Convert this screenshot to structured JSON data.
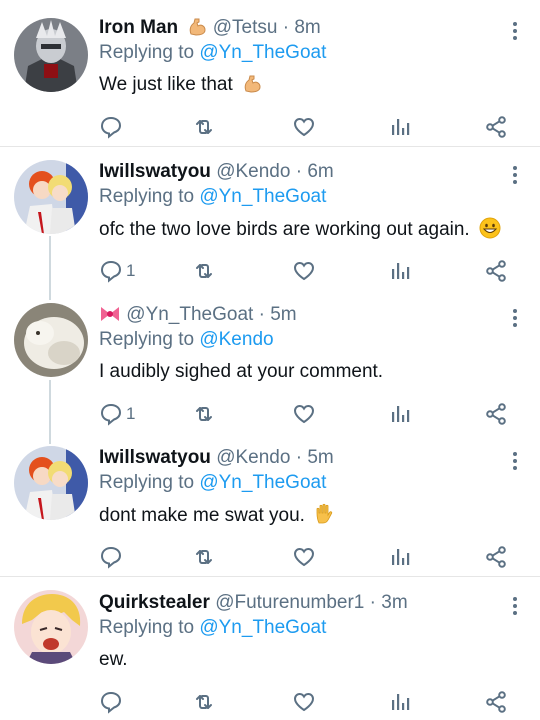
{
  "tweets": [
    {
      "name": "Iron Man",
      "name_emoji": "flexed-biceps",
      "handle": "@Tetsu",
      "separator": "·",
      "time": "8m",
      "replying_prefix": "Replying to ",
      "replying_to": "@Yn_TheGoat",
      "text": "We just like that",
      "text_emoji": "flexed-biceps",
      "reply_count": "",
      "avatar": "armored-figure-avatar"
    },
    {
      "name": "Iwillswatyou",
      "handle": "@Kendo",
      "separator": "·",
      "time": "6m",
      "replying_prefix": "Replying to ",
      "replying_to": "@Yn_TheGoat",
      "text": "ofc the two love birds are working out again.",
      "text_emoji": "grinning-face",
      "reply_count": "1",
      "avatar": "anime-pair-avatar"
    },
    {
      "name": "",
      "name_emoji": "ribbon",
      "handle": "@Yn_TheGoat",
      "separator": "·",
      "time": "5m",
      "replying_prefix": "Replying to ",
      "replying_to": "@Kendo",
      "text": "I audibly sighed at your comment.",
      "reply_count": "1",
      "avatar": "fluffy-white-animal-avatar"
    },
    {
      "name": "Iwillswatyou",
      "handle": "@Kendo",
      "separator": "·",
      "time": "5m",
      "replying_prefix": "Replying to ",
      "replying_to": "@Yn_TheGoat",
      "text": "dont make me swat you.",
      "text_emoji": "raised-hand",
      "reply_count": "",
      "avatar": "anime-pair-avatar"
    },
    {
      "name": "Quirkstealer",
      "handle": "@Futurenumber1",
      "separator": "·",
      "time": "3m",
      "replying_prefix": "Replying to ",
      "replying_to": "@Yn_TheGoat",
      "text": "ew.",
      "reply_count": "",
      "avatar": "blonde-anime-character-avatar"
    }
  ],
  "colors": {
    "link": "#1d9bf0",
    "secondary_text": "#5b7083",
    "primary_text": "#0f1419",
    "divider": "#e6e6e6",
    "thread_line": "#cfd9de"
  },
  "action_icons": [
    "reply-icon",
    "retweet-icon",
    "like-icon",
    "analytics-icon",
    "share-icon"
  ]
}
